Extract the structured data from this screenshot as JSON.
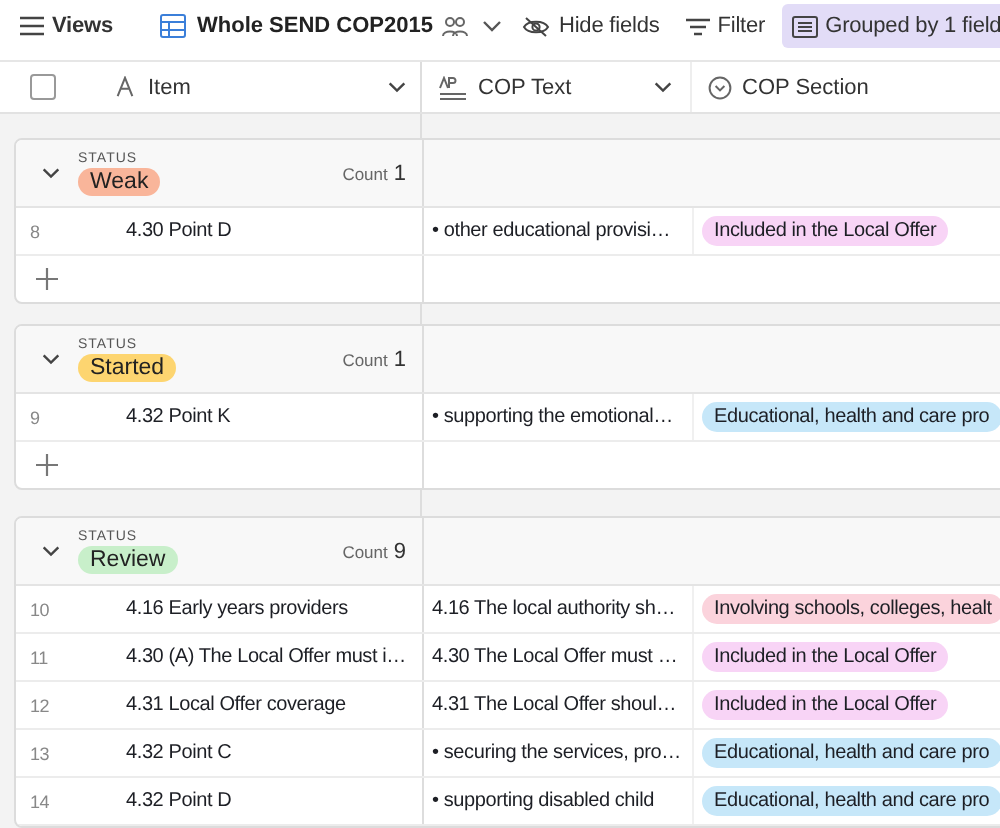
{
  "toolbar": {
    "views": "Views",
    "view_name": "Whole SEND COP2015",
    "hide_fields": "Hide fields",
    "filter": "Filter",
    "grouped": "Grouped by 1 field",
    "grouped_active": true
  },
  "select_all": {
    "checked": false
  },
  "columns": [
    {
      "label": "Item",
      "kind": "text"
    },
    {
      "label": "COP Text",
      "kind": "longtext"
    },
    {
      "label": "COP Section",
      "kind": "select"
    }
  ],
  "groups": [
    {
      "field": "STATUS",
      "value": "Weak",
      "color": "#f9b59a",
      "count_label": "Count",
      "count": "1",
      "expanded": true,
      "add_row": true,
      "rows": [
        {
          "number": "8",
          "item": "4.30 Point D",
          "text": "• other educational provisi…",
          "section": {
            "label": "Included in the Local Offer",
            "color": "#f8d4f6"
          }
        }
      ]
    },
    {
      "field": "STATUS",
      "value": "Started",
      "color": "#fdd570",
      "count_label": "Count",
      "count": "1",
      "expanded": true,
      "add_row": true,
      "rows": [
        {
          "number": "9",
          "item": "4.32 Point K",
          "text": "• supporting the emotional…",
          "section": {
            "label": "Educational, health and care pro",
            "color": "#c6e7f9"
          }
        }
      ]
    },
    {
      "field": "STATUS",
      "value": "Review",
      "color": "#c8efca",
      "count_label": "Count",
      "count": "9",
      "expanded": true,
      "rows": [
        {
          "number": "10",
          "item": "4.16 Early years providers",
          "text": "4.16 The local authority sh…",
          "section": {
            "label": "Involving schools, colleges, healt",
            "color": "#fbd3dc"
          }
        },
        {
          "number": "11",
          "item": "4.30 (A) The Local Offer must i…",
          "text": "4.30 The Local Offer must …",
          "section": {
            "label": "Included in the Local Offer",
            "color": "#f8d4f6"
          }
        },
        {
          "number": "12",
          "item": "4.31 Local Offer coverage",
          "text": "4.31 The Local Offer shoul…",
          "section": {
            "label": "Included in the Local Offer",
            "color": "#f8d4f6"
          }
        },
        {
          "number": "13",
          "item": "4.32 Point C",
          "text": "• securing the services, pro…",
          "section": {
            "label": "Educational, health and care pro",
            "color": "#c6e7f9"
          }
        },
        {
          "number": "14",
          "item": "4.32 Point D",
          "text": "• supporting disabled child",
          "section": {
            "label": "Educational, health and care pro",
            "color": "#c6e7f9"
          }
        }
      ]
    }
  ]
}
